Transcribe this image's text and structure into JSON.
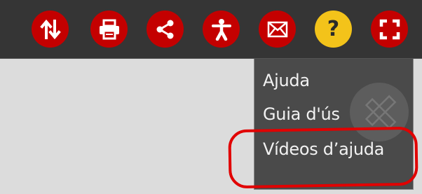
{
  "toolbar": {
    "buttons": [
      {
        "name": "sort-button",
        "icon": "sort-arrows-icon",
        "color": "#c40000"
      },
      {
        "name": "print-button",
        "icon": "printer-icon",
        "color": "#c40000"
      },
      {
        "name": "share-button",
        "icon": "share-icon",
        "color": "#c40000"
      },
      {
        "name": "accessibility-button",
        "icon": "accessibility-icon",
        "color": "#c40000"
      },
      {
        "name": "email-button",
        "icon": "envelope-icon",
        "color": "#c40000"
      },
      {
        "name": "help-button",
        "icon": "question-mark-icon",
        "color": "#f3c31a",
        "label": "?"
      },
      {
        "name": "fullscreen-button",
        "icon": "fullscreen-icon",
        "color": "#c40000"
      }
    ]
  },
  "help_menu": {
    "items": [
      "Ajuda",
      "Guia d'ús",
      "Vídeos d’ajuda"
    ],
    "watermark_icon": "ruler-pencil-icon"
  },
  "annotation": {
    "color": "#e10000",
    "target": "Vídeos d’ajuda"
  }
}
